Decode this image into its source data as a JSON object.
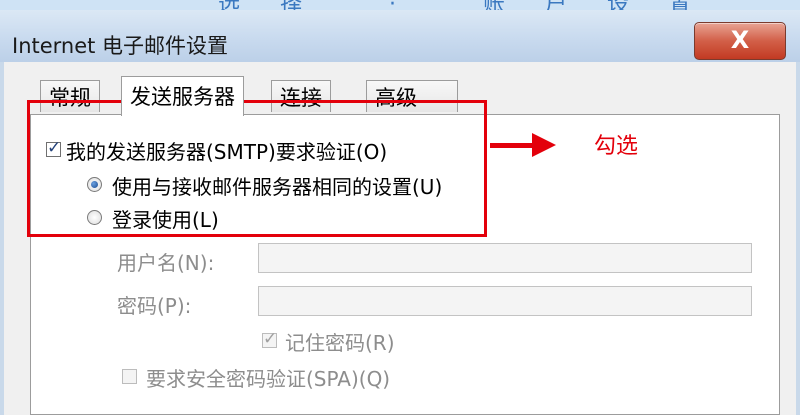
{
  "banner_text": "选择 · 账户设置",
  "window": {
    "title": "Internet 电子邮件设置",
    "close_label": "X"
  },
  "tabs": [
    {
      "label": "常规"
    },
    {
      "label": "发送服务器"
    },
    {
      "label": "连接"
    },
    {
      "label": "高级"
    }
  ],
  "smtp_auth": {
    "checkbox_label": "我的发送服务器(SMTP)要求验证(O)",
    "checked": true,
    "radio_same": "使用与接收邮件服务器相同的设置(U)",
    "radio_login": "登录使用(L)",
    "selected": "same"
  },
  "login": {
    "username_label": "用户名(N):",
    "username_value": "",
    "password_label": "密码(P):",
    "password_value": "",
    "remember_label": "记住密码(R)",
    "remember_checked": true,
    "spa_label": "要求安全密码验证(SPA)(Q)",
    "spa_checked": false
  },
  "annotation": {
    "text": "勾选",
    "color": "#e3000b"
  }
}
